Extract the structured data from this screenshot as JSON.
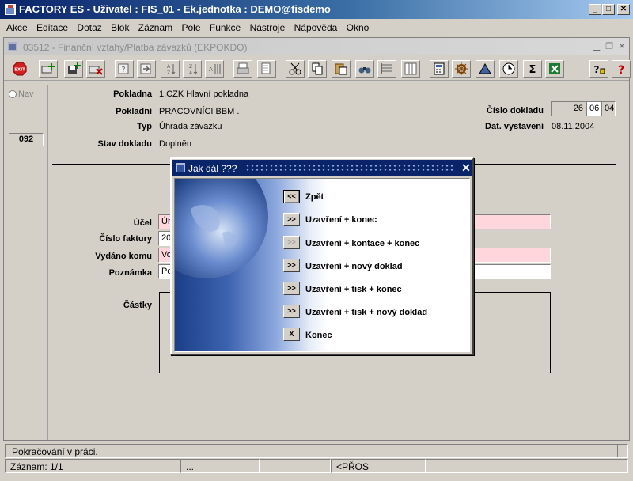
{
  "window": {
    "title": "FACTORY ES - Uživatel : FIS_01 - Ek.jednotka : DEMO@fisdemo",
    "controls": [
      "_",
      "□",
      "✕"
    ]
  },
  "menu": [
    "Akce",
    "Editace",
    "Dotaz",
    "Blok",
    "Záznam",
    "Pole",
    "Funkce",
    "Nástroje",
    "Nápověda",
    "Okno"
  ],
  "form": {
    "title": "03512 - Finanční vztahy/Platba závazků (EKPOKDO)"
  },
  "toolbar": {
    "exit_label": "EXIT",
    "sigma": "Σ",
    "help_label": "?"
  },
  "nav": {
    "label": "Nav",
    "record_no": "092"
  },
  "header": {
    "pokladna_label": "Pokladna",
    "pokladna_value": "1.CZK Hlavní pokladna",
    "pokladni_label": "Pokladní",
    "pokladni_value": "PRACOVNÍCI BBM .",
    "typ_label": "Typ",
    "typ_value": "Úhrada závazku",
    "stav_label": "Stav dokladu",
    "stav_value": "Doplněn",
    "cislo_label": "Číslo dokladu",
    "cislo_parts": [
      "26",
      "06",
      "04"
    ],
    "datum_label": "Dat. vystavení",
    "datum_value": "08.11.2004"
  },
  "detail": {
    "ucel_label": "Účel",
    "ucel_value": "Úh",
    "faktura_label": "Číslo faktury",
    "faktura_value": "20",
    "vydano_label": "Vydáno komu",
    "vydano_value": "Vo",
    "poznamka_label": "Poznámka",
    "poznamka_value": "Po",
    "castky_label": "Částky"
  },
  "dialog": {
    "title": "Jak dál ???",
    "close": "✕",
    "options": [
      {
        "btn": "<<",
        "label": "Zpět",
        "enabled": true,
        "selected": true
      },
      {
        "btn": ">>",
        "label": "Uzavření + konec",
        "enabled": true
      },
      {
        "btn": ">>",
        "label": "Uzavření + kontace + konec",
        "enabled": false
      },
      {
        "btn": ">>",
        "label": "Uzavření + nový doklad",
        "enabled": true
      },
      {
        "btn": ">>",
        "label": "Uzavření + tisk + konec",
        "enabled": true
      },
      {
        "btn": ">>",
        "label": "Uzavření + tisk + nový doklad",
        "enabled": true
      },
      {
        "btn": "X",
        "label": "Konec",
        "enabled": true
      }
    ]
  },
  "status": {
    "message": "Pokračování v práci.",
    "record": "Záznam: 1/1",
    "dots": "...",
    "mode": "<PŘOS"
  }
}
